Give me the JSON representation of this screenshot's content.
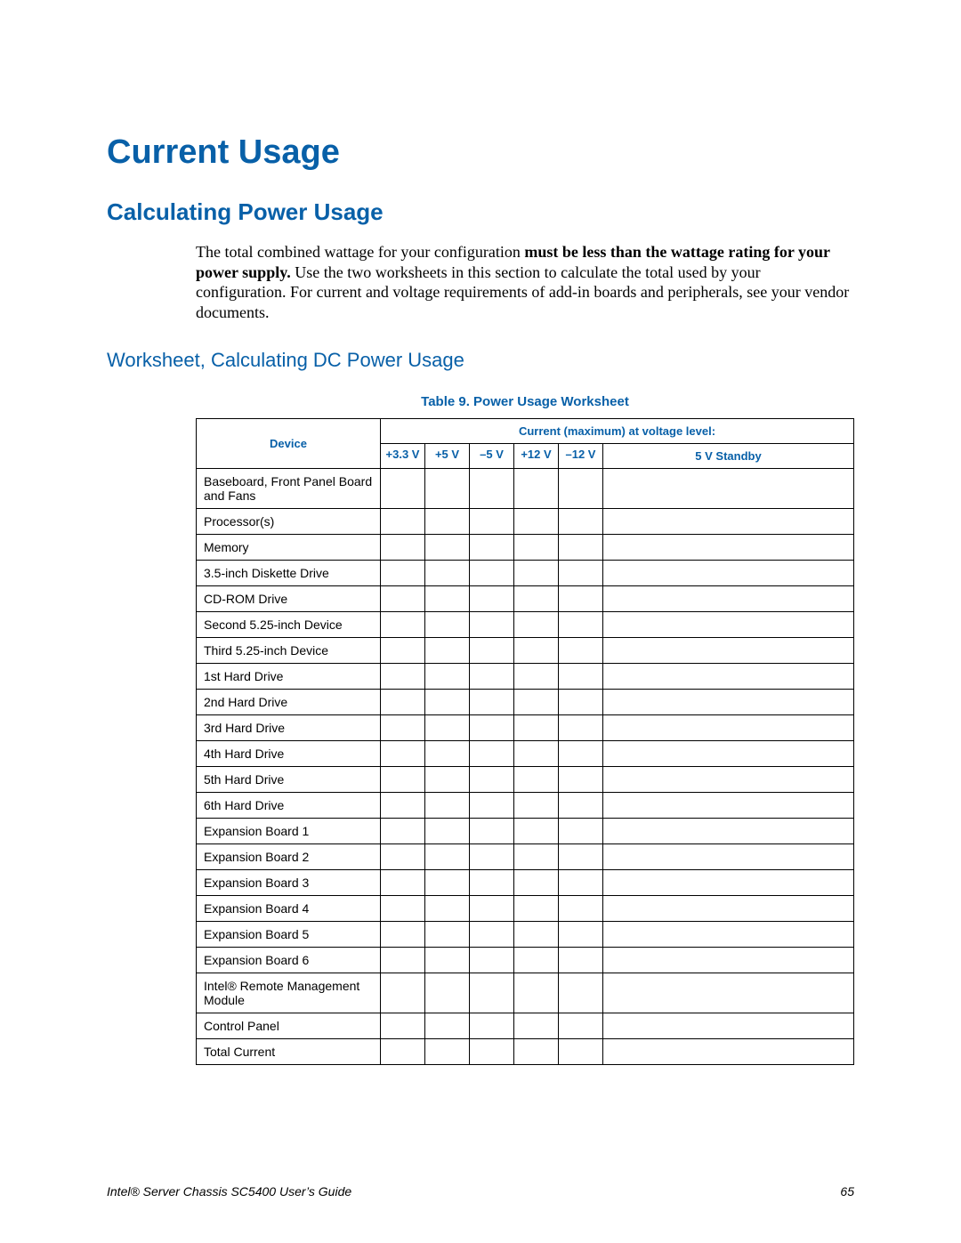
{
  "title": "Current Usage",
  "section": "Calculating Power Usage",
  "body_pre": "The total combined wattage for your configuration ",
  "body_bold": "must be less than the wattage rating for your power supply.",
  "body_post": " Use the two worksheets in this section to calculate the total used by your configuration. For current and voltage requirements of add-in boards and peripherals, see your vendor documents.",
  "worksheet_heading": "Worksheet, Calculating DC Power Usage",
  "table_caption": "Table 9. Power Usage Worksheet",
  "headers": {
    "group": "Current (maximum) at voltage level:",
    "device": "Device",
    "c1": "+3.3 V",
    "c2": "+5 V",
    "c3": "–5 V",
    "c4": "+12 V",
    "c5": "–12 V",
    "c6": "5 V Standby"
  },
  "rows": [
    "Baseboard, Front Panel Board and Fans",
    "Processor(s)",
    "Memory",
    "3.5-inch Diskette Drive",
    "CD-ROM Drive",
    "Second 5.25-inch Device",
    "Third 5.25-inch Device",
    "1st Hard Drive",
    "2nd Hard Drive",
    "3rd Hard Drive",
    "4th Hard Drive",
    "5th Hard Drive",
    "6th Hard Drive",
    "Expansion Board 1",
    "Expansion Board 2",
    "Expansion Board 3",
    "Expansion Board 4",
    "Expansion Board 5",
    "Expansion Board 6",
    "Intel® Remote Management Module",
    "Control Panel",
    "Total Current"
  ],
  "footer_left": "Intel® Server Chassis SC5400 User’s Guide",
  "footer_right": "65"
}
